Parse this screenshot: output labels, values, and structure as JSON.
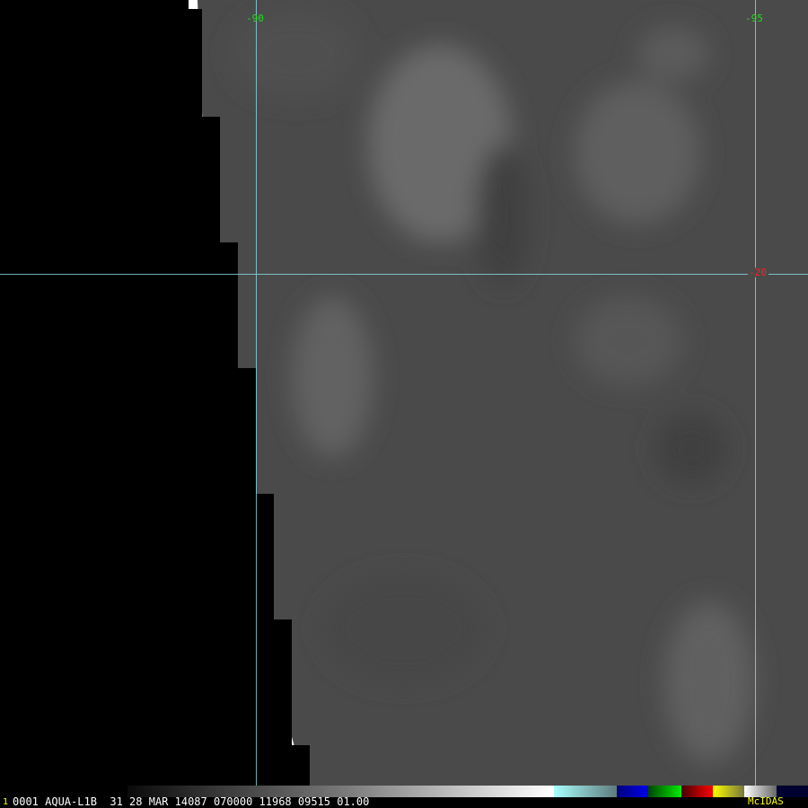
{
  "image": {
    "grid_labels": {
      "lon_left": "-90",
      "lon_right": "-95",
      "lat": "-20"
    },
    "colors": {
      "grid": "#8fe6ee",
      "lon_label": "#22dd22",
      "lat_label": "#ff2020",
      "background": "#4a4a4a"
    }
  },
  "status_bar": {
    "frame": "1",
    "text": "0001 AQUA-L1B  31 28 MAR 14087 070000 11968 09515 01.00",
    "brand": "McIDAS"
  }
}
